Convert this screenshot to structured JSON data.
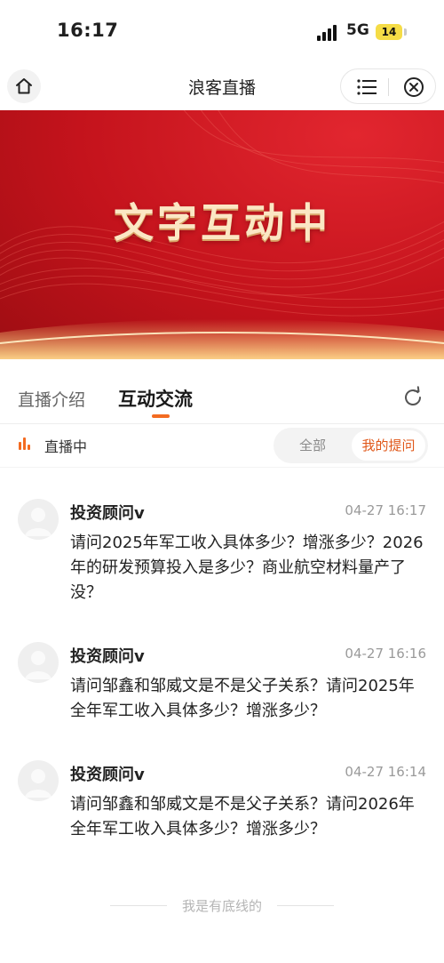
{
  "status_bar": {
    "time": "16:17",
    "network": "5G",
    "battery": "14",
    "battery_color": "#f5dc46"
  },
  "nav": {
    "title": "浪客直播",
    "home_icon": "home-icon",
    "menu_icon": "menu-icon",
    "close_icon": "close-circle-icon"
  },
  "banner": {
    "title": "文字互动中",
    "background_color": "#c4131c"
  },
  "tabs": [
    {
      "label": "直播介绍",
      "active": false
    },
    {
      "label": "互动交流",
      "active": true
    }
  ],
  "accent_color": "#f36b21",
  "live": {
    "status_label": "直播中",
    "filters": [
      {
        "label": "全部",
        "active": false
      },
      {
        "label": "我的提问",
        "active": true
      }
    ]
  },
  "messages": [
    {
      "name": "投资顾问v",
      "time": "04-27 16:17",
      "text": "请问2025年军工收入具体多少？增涨多少？2026年的研发预算投入是多少？商业航空材料量产了没？"
    },
    {
      "name": "投资顾问v",
      "time": "04-27 16:16",
      "text": "请问邹鑫和邹威文是不是父子关系？请问2025年全年军工收入具体多少？增涨多少？"
    },
    {
      "name": "投资顾问v",
      "time": "04-27 16:14",
      "text": "请问邹鑫和邹威文是不是父子关系？请问2026年全年军工收入具体多少？增涨多少？"
    }
  ],
  "footer": {
    "end_text": "我是有底线的"
  }
}
